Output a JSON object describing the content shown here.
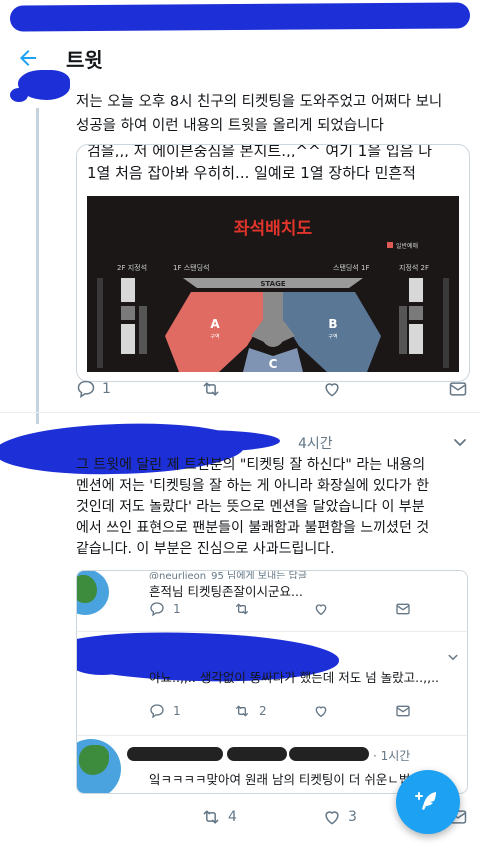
{
  "header": {
    "title": "트윗"
  },
  "tweet1": {
    "partial_line": "검을,,, 저 에이븐중심을 본지트.,,^^ 여기 1을 입음 나",
    "text_lines": [
      "저는 오늘 오후 8시 친구의 티켓팅을 도와주었고 어쩌다 보니",
      "성공을 하여 이런 내용의 트윗을 올리게 되었습니다"
    ],
    "quote_lines": [
      "검을,,, 저 에이븐중심을 본지트.,,^^ 여기 1을 입음 나",
      "1열 처음 잡아봐 우히히... 일예로 1열 장하다 민흔적"
    ],
    "seat_map": {
      "title": "좌석배치도",
      "legend": "일반예매",
      "stage": "STAGE",
      "left_floor": "2F 지정석",
      "left_stand": "1F 스탠딩석",
      "right_stand": "스탠딩석 1F",
      "right_floor": "지정석 2F",
      "zone_a": "A",
      "zone_b": "B",
      "zone_c": "C",
      "zone_sub": "구역"
    },
    "reply_count": "1"
  },
  "tweet2": {
    "time": "4시간",
    "text_lines": [
      "그 트윗에 달린 제 트친분의 \"티켓팅 잘 하신다\" 라는 내용의",
      "멘션에 저는 '티켓팅을 잘 하는 게 아니라 화장실에 있다가 한",
      "것인데 저도 놀랐다' 라는 뜻으로 멘션을 달았습니다 이 부분",
      "에서 쓰인 표현으로 팬분들이 불쾌함과 불편함을 느끼셨던 것",
      "같습니다. 이 부분은 진심으로 사과드립니다."
    ],
    "quoted": [
      {
        "handle": "@neurljeon_95 님에게 보내는 답글",
        "text": "흔적님 티켓팅존잘이시군요...",
        "reply": "1",
        "retweet": "",
        "like": ""
      },
      {
        "handle": "",
        "text": "아뇨..,,.. 생각없이 똥싸다가 했는데 저도 넘 놀랐고..,,..",
        "reply": "1",
        "retweet": "2",
        "like": ""
      },
      {
        "handle": "· 1시간",
        "text": "잌ㅋㅋㅋㅋ맞아여 원래 남의 티켓팅이 더 쉬운ㄴ법..",
        "reply": "",
        "retweet": "",
        "like": ""
      }
    ],
    "retweet_count": "4",
    "like_count": "3"
  },
  "colors": {
    "accent": "#1da1f2",
    "scribble": "#1d2fd6",
    "muted": "#657786"
  }
}
